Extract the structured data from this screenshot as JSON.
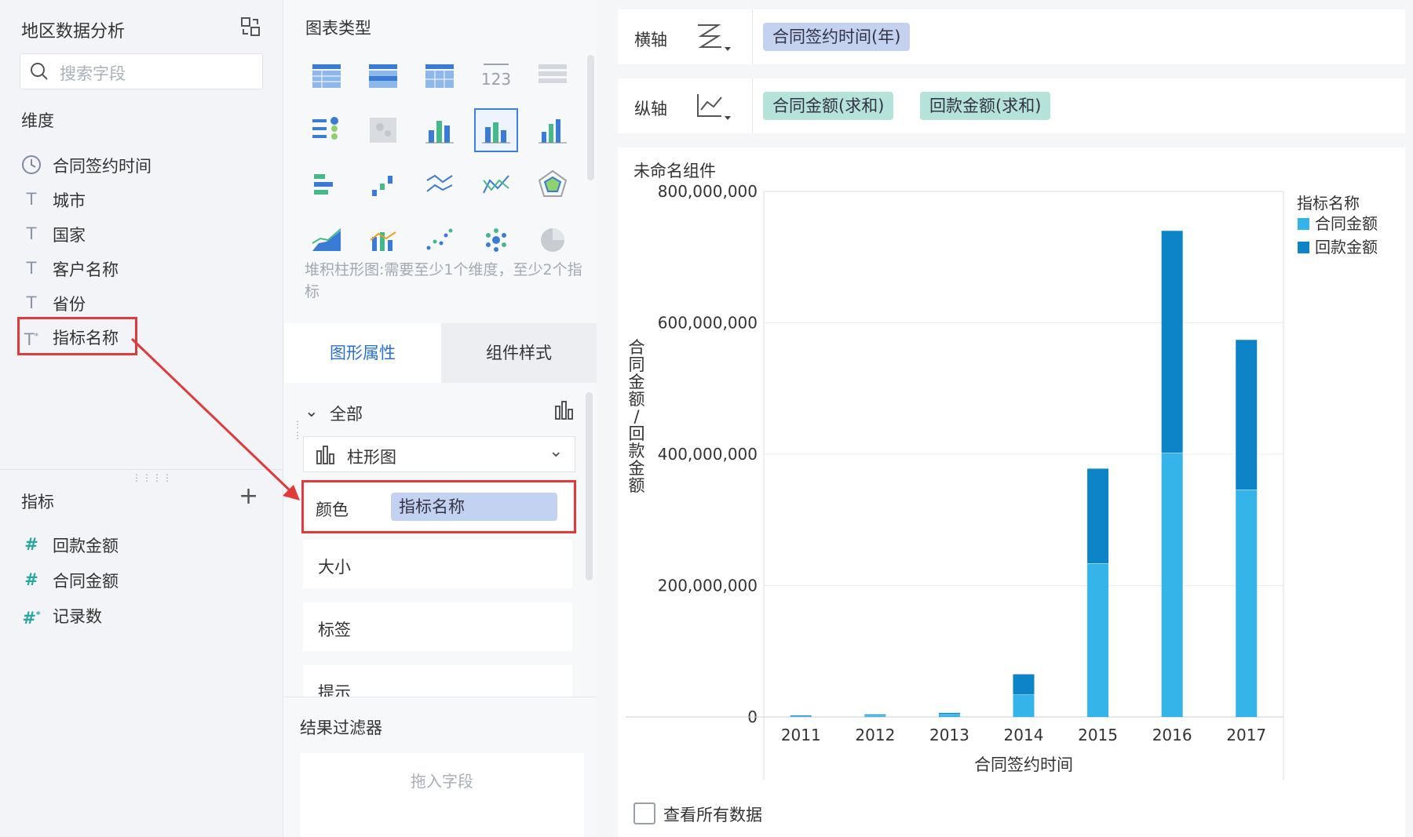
{
  "left": {
    "title": "地区数据分析",
    "search_placeholder": "搜索字段",
    "dimensions_heading": "维度",
    "dimensions": [
      {
        "icon": "clock-icon",
        "label": "合同签约时间"
      },
      {
        "icon": "text-type-icon",
        "label": "城市"
      },
      {
        "icon": "text-type-icon",
        "label": "国家"
      },
      {
        "icon": "text-type-icon",
        "label": "客户名称"
      },
      {
        "icon": "text-type-icon",
        "label": "省份"
      },
      {
        "icon": "text-type-star-icon",
        "label": "指标名称"
      }
    ],
    "metrics_heading": "指标",
    "metrics": [
      {
        "icon": "hash-icon",
        "label": "回款金额"
      },
      {
        "icon": "hash-icon",
        "label": "合同金额"
      },
      {
        "icon": "hash-star-icon",
        "label": "记录数"
      }
    ]
  },
  "middle": {
    "chart_type_heading": "图表类型",
    "chart_hint": "堆积柱形图:需要至少1个维度，至少2个指标",
    "tab_graphic": "图形属性",
    "tab_style": "组件样式",
    "all_label": "全部",
    "chart_select": "柱形图",
    "color_label": "颜色",
    "color_field": "指标名称",
    "size_label": "大小",
    "tag_label": "标签",
    "tip_label": "提示",
    "filter_heading": "结果过滤器",
    "drop_hint": "拖入字段"
  },
  "right": {
    "x_axis_label": "横轴",
    "x_field": "合同签约时间(年)",
    "y_axis_label": "纵轴",
    "y_fields": [
      "合同金额(求和)",
      "回款金额(求和)"
    ],
    "widget_title": "未命名组件",
    "view_all": "查看所有数据"
  },
  "colors": {
    "contract": "#35b4ea",
    "payment": "#0d83c8",
    "accent": "#2a6fd6"
  },
  "chart_data": {
    "type": "bar",
    "stacked": true,
    "categories": [
      "2011",
      "2012",
      "2013",
      "2014",
      "2015",
      "2016",
      "2017"
    ],
    "series": [
      {
        "name": "合同金额",
        "values": [
          1500000,
          2500000,
          4000000,
          34000000,
          234000000,
          402000000,
          346000000
        ]
      },
      {
        "name": "回款金额",
        "values": [
          800000,
          1400000,
          2200000,
          31000000,
          144000000,
          338000000,
          228000000
        ]
      }
    ],
    "xlabel": "合同签约时间",
    "ylabel": "合同金额/回款金额",
    "ylim": [
      0,
      800000000
    ],
    "yticks": [
      "0",
      "200,000,000",
      "400,000,000",
      "600,000,000",
      "800,000,000"
    ],
    "legend_title": "指标名称",
    "legend_position": "right",
    "grid": true
  }
}
